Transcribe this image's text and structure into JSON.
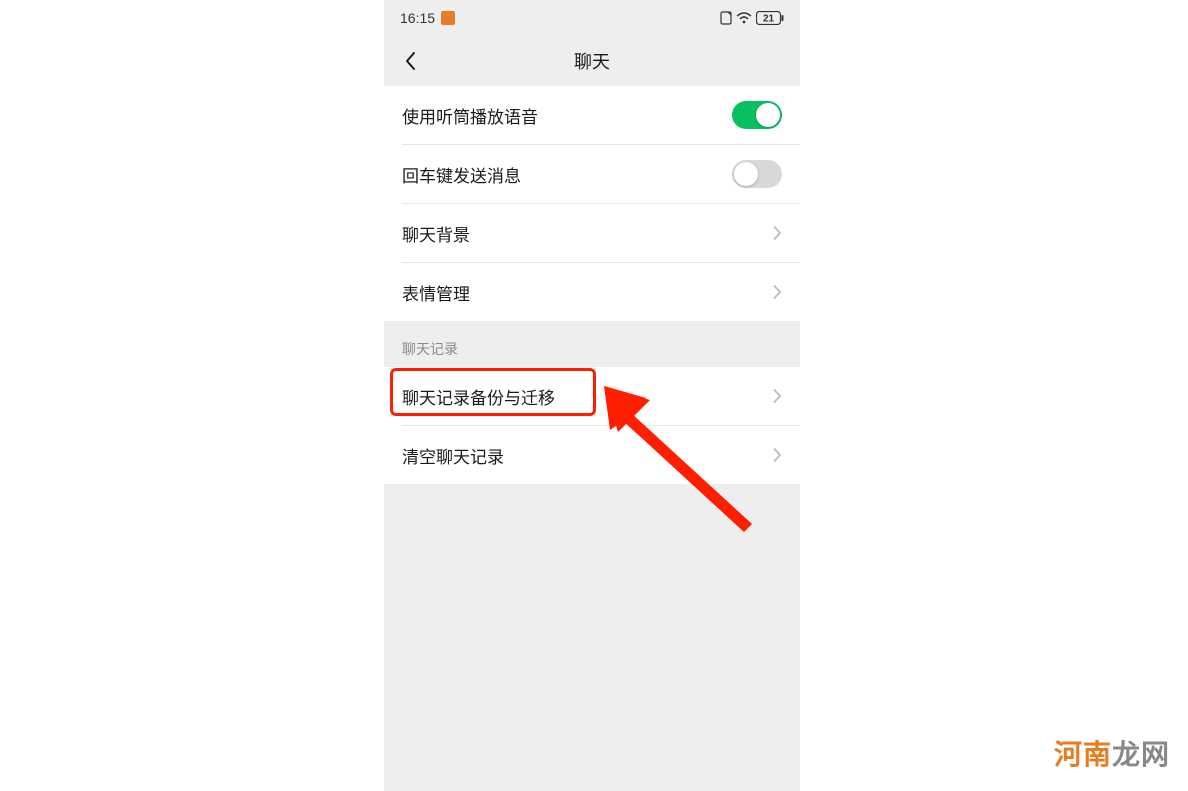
{
  "status_bar": {
    "time": "16:15",
    "battery_text": "21"
  },
  "nav": {
    "title": "聊天"
  },
  "group_general": {
    "speaker": {
      "label": "使用听筒播放语音",
      "enabled": true
    },
    "enter_send": {
      "label": "回车键发送消息",
      "enabled": false
    },
    "chat_bg": {
      "label": "聊天背景"
    },
    "sticker_mgmt": {
      "label": "表情管理"
    }
  },
  "section_history": {
    "header": "聊天记录",
    "backup_migrate": {
      "label": "聊天记录备份与迁移"
    },
    "clear": {
      "label": "清空聊天记录"
    }
  },
  "watermark": {
    "brand_a": "河南",
    "brand_b": "龙网"
  },
  "colors": {
    "accent_green": "#07c160",
    "highlight_red": "#ff1e00",
    "brand_orange": "#e77b1f"
  }
}
